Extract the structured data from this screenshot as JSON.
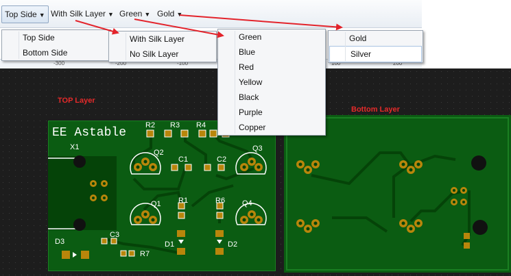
{
  "toolbar": {
    "side": "Top Side",
    "silk": "With Silk Layer",
    "color": "Green",
    "finish": "Gold"
  },
  "menus": {
    "side": [
      "Top Side",
      "Bottom Side"
    ],
    "silk": [
      "With Silk Layer",
      "No Silk Layer"
    ],
    "color": [
      "Green",
      "Blue",
      "Red",
      "Yellow",
      "Black",
      "Purple",
      "Copper"
    ],
    "finish": [
      "Gold",
      "Silver"
    ]
  },
  "ruler_ticks": [
    "-300",
    "-200",
    "-100",
    "100",
    "200"
  ],
  "layers": {
    "top": "TOP Layer",
    "bottom": "Bottom Layer"
  },
  "board": {
    "title": "EE Astable",
    "refs": [
      "R2",
      "R3",
      "R4",
      "X1",
      "Q2",
      "C1",
      "C2",
      "Q3",
      "Q1",
      "R1",
      "R6",
      "Q4",
      "C3",
      "D3",
      "R7",
      "D1",
      "D2"
    ]
  },
  "colors": {
    "pcb": "#0b5c12",
    "pcb_dark": "#054308",
    "copper": "#b8860b",
    "silk": "#ffffff",
    "arrow": "#e3232b",
    "label": "#e42a2a"
  }
}
